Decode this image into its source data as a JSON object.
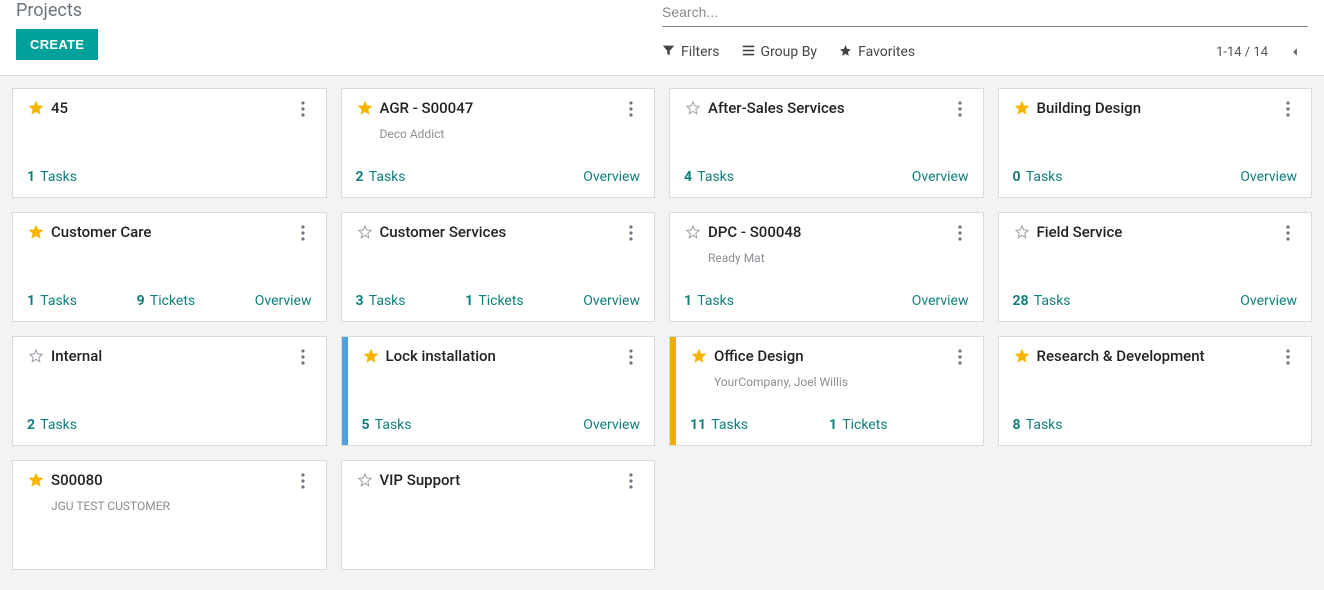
{
  "header": {
    "title": "Projects",
    "create_label": "CREATE"
  },
  "search": {
    "placeholder": "Search..."
  },
  "controls": {
    "filters": "Filters",
    "group_by": "Group By",
    "favorites": "Favorites",
    "pager": "1-14 / 14"
  },
  "labels": {
    "tasks": "Tasks",
    "tickets": "Tickets",
    "overview": "Overview"
  },
  "cards": [
    {
      "title": "45",
      "star": true,
      "subtitle": "",
      "tasks": 1,
      "tickets": null,
      "overview": false,
      "edge": ""
    },
    {
      "title": "AGR - S00047",
      "star": true,
      "subtitle": "Deco Addict",
      "tasks": 2,
      "tickets": null,
      "overview": true,
      "edge": ""
    },
    {
      "title": "After-Sales Services",
      "star": false,
      "subtitle": "",
      "tasks": 4,
      "tickets": null,
      "overview": true,
      "edge": ""
    },
    {
      "title": "Building Design",
      "star": true,
      "subtitle": "",
      "tasks": 0,
      "tickets": null,
      "overview": true,
      "edge": ""
    },
    {
      "title": "Customer Care",
      "star": true,
      "subtitle": "",
      "tasks": 1,
      "tickets": 9,
      "overview": true,
      "edge": ""
    },
    {
      "title": "Customer Services",
      "star": false,
      "subtitle": "",
      "tasks": 3,
      "tickets": 1,
      "overview": true,
      "edge": ""
    },
    {
      "title": "DPC - S00048",
      "star": false,
      "subtitle": "Ready Mat",
      "tasks": 1,
      "tickets": null,
      "overview": true,
      "edge": ""
    },
    {
      "title": "Field Service",
      "star": false,
      "subtitle": "",
      "tasks": 28,
      "tickets": null,
      "overview": true,
      "edge": ""
    },
    {
      "title": "Internal",
      "star": false,
      "subtitle": "",
      "tasks": 2,
      "tickets": null,
      "overview": false,
      "edge": ""
    },
    {
      "title": "Lock installation",
      "star": true,
      "subtitle": "",
      "tasks": 5,
      "tickets": null,
      "overview": true,
      "edge": "blue"
    },
    {
      "title": "Office Design",
      "star": true,
      "subtitle": "YourCompany, Joel Willis",
      "tasks": 11,
      "tickets": 1,
      "overview": false,
      "edge": "yellow"
    },
    {
      "title": "Research & Development",
      "star": true,
      "subtitle": "",
      "tasks": 8,
      "tickets": null,
      "overview": false,
      "edge": ""
    },
    {
      "title": "S00080",
      "star": true,
      "subtitle": "JGU TEST CUSTOMER",
      "tasks": null,
      "tickets": null,
      "overview": false,
      "edge": ""
    },
    {
      "title": "VIP Support",
      "star": false,
      "subtitle": "",
      "tasks": null,
      "tickets": null,
      "overview": false,
      "edge": ""
    }
  ]
}
